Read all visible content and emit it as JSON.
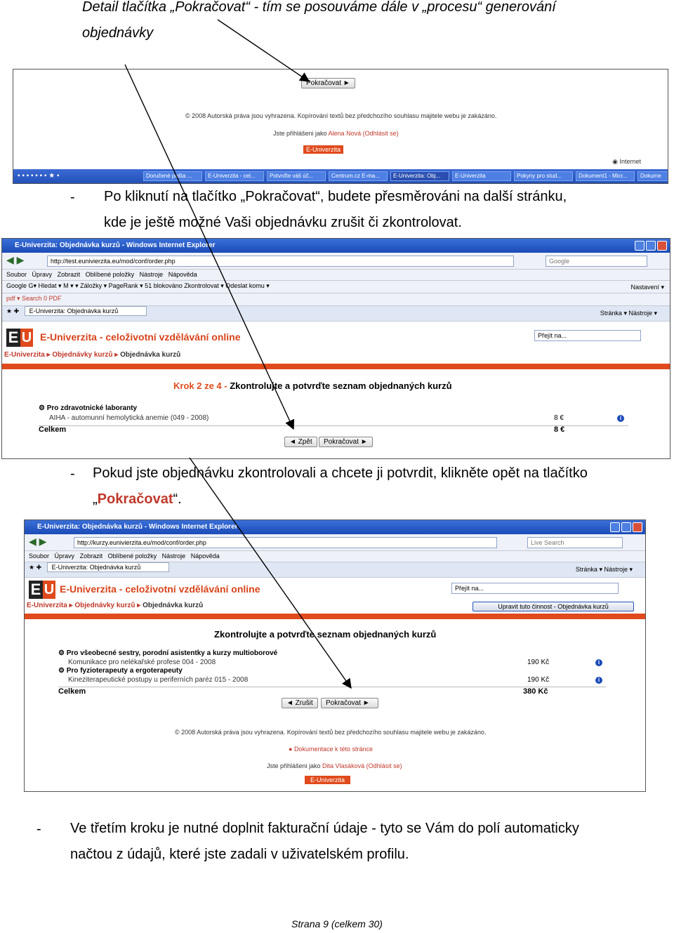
{
  "intro": {
    "line1": "Detail tlačítka „Pokračovat“ - tím se posouváme dále v „procesu“ generování",
    "line2": "objednávky"
  },
  "shot1": {
    "button": "Pokračovat ►",
    "copyright": "© 2008 Autorská práva jsou vyhrazena. Kopírování textů bez předchozího souhlasu majitele webu je zakázáno.",
    "logged_prefix": "Jste přihlášeni jako ",
    "logged_user": "Alena Nová",
    "logout": " (Odhlásit se)",
    "badge": "E-Univerzita",
    "status": "Internet",
    "tasks": [
      "Doručené pošta ...",
      "E-Univerzita - cel...",
      "Potvrďte váš úč...",
      "Centrum.cz E-ma...",
      "E-Univerzita: Obj...",
      "E-Univerzita",
      "Pokyny pro stud...",
      "Dokument1 - Micr...",
      "Dokume"
    ]
  },
  "para2": {
    "dash": "-",
    "line1": "Po kliknutí na tlačítko „Pokračovat“, budete přesměrováni na další stránku,",
    "line2": "kde je ještě možné Vaši objednávku zrušit či zkontrolovat."
  },
  "shot2": {
    "title": "E-Univerzita: Objednávka kurzů - Windows Internet Explorer",
    "url": "http://test.eunivierzita.eu/mod/conf/order.php",
    "search": "Google",
    "menu": [
      "Soubor",
      "Úpravy",
      "Zobrazit",
      "Oblíbené položky",
      "Nástroje",
      "Nápověda"
    ],
    "google_bar": "Google  G▾     Hledat ▾   M ▾   ▾     Záložky ▾  PageRank ▾   51 blokováno    Zkontrolovat ▾   Odeslat komu ▾",
    "settings": "Nastavení ▾",
    "pdf_bar": "pdf ▾   Search   0   PDF",
    "tab": "E-Univerzita: Objednávka kurzů",
    "tools": "Stránka ▾   Nástroje ▾",
    "site_title": "E-Univerzita - celoživotní vzdělávání online",
    "jump": "Přejít na...",
    "crumbs": [
      "E-Univerzita",
      "Objednávky kurzů",
      "Objednávka kurzů"
    ],
    "step_prefix": "Krok 2 ze 4 - ",
    "step_title": "Zkontrolujte a potvrďte seznam objednaných kurzů",
    "course": "Pro zdravotnické laboranty",
    "course_sub": "AIHA - automunní hemolytická anemie (049 - 2008)",
    "price": "8 €",
    "total_label": "Celkem",
    "total": "8 €",
    "back": "◄ Zpět",
    "next": "Pokračovat ►"
  },
  "para3": {
    "dash": "-",
    "line1": "Pokud jste objednávku zkontrolovali a chcete ji potvrdit, klikněte opět na tlačítko",
    "open_quote": "„",
    "highlight": "Pokračovat",
    "close_quote": "“."
  },
  "shot3": {
    "title": "E-Univerzita: Objednávka kurzů - Windows Internet Explorer",
    "url": "http://kurzy.eunivierzita.eu/mod/conf/order.php",
    "search": "Live Search",
    "menu": [
      "Soubor",
      "Úpravy",
      "Zobrazit",
      "Oblíbené položky",
      "Nástroje",
      "Nápověda"
    ],
    "tab": "E-Univerzita: Objednávka kurzů",
    "tools": "Stránka ▾   Nástroje ▾",
    "site_title": "E-Univerzita - celoživotní vzdělávání online",
    "jump": "Přejít na...",
    "edit_btn": "Upravit tuto činnost - Objednávka kurzů",
    "crumbs": [
      "E-Univerzita",
      "Objednávky kurzů",
      "Objednávka kurzů"
    ],
    "heading": "Zkontrolujte a potvrďte seznam objednaných kurzů",
    "course1": "Pro všeobecné sestry, porodní asistentky a kurzy multioborové",
    "course1_sub": "Komunikace pro nelékařské profese 004 - 2008",
    "price1": "190 Kč",
    "course2": "Pro fyzioterapeuty a ergoterapeuty",
    "course2_sub": "Kineziterapeutické postupy u periferních paréz 015 - 2008",
    "price2": "190 Kč",
    "total_label": "Celkem",
    "total": "380 Kč",
    "back": "◄ Zrušit",
    "next": "Pokračovat ►",
    "copyright": "© 2008 Autorská práva jsou vyhrazena. Kopírování textů bez předchozího souhlasu majitele webu je zakázáno.",
    "docs": "Dokumentace k této stránce",
    "logged_prefix": "Jste přihlášeni jako ",
    "logged_user": "Dita Vlasáková",
    "logout": " (Odhlásit se)",
    "badge": "E-Univerzita"
  },
  "para4": {
    "dash": "-",
    "line1": "Ve třetím kroku je nutné doplnit fakturační údaje - tyto se Vám do polí automaticky",
    "line2": "načtou z údajů, které jste zadali v uživatelském profilu."
  },
  "footer": "Strana 9 (celkem 30)",
  "colors": {
    "accent": "#e04a1c",
    "ie_blue": "#1b4bb8"
  }
}
